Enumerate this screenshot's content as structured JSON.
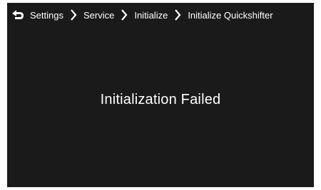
{
  "breadcrumb": {
    "items": [
      {
        "label": "Settings",
        "icon": "chevron-right-icon"
      },
      {
        "label": "Service",
        "icon": "chevron-right-icon"
      },
      {
        "label": "Initialize",
        "icon": "chevron-right-icon"
      },
      {
        "label": "Initialize Quickshifter"
      }
    ],
    "back_icon": "back-arrow-icon"
  },
  "main": {
    "message": "Initialization Failed"
  },
  "colors": {
    "background": "#1a1a1a",
    "text": "#ffffff"
  }
}
